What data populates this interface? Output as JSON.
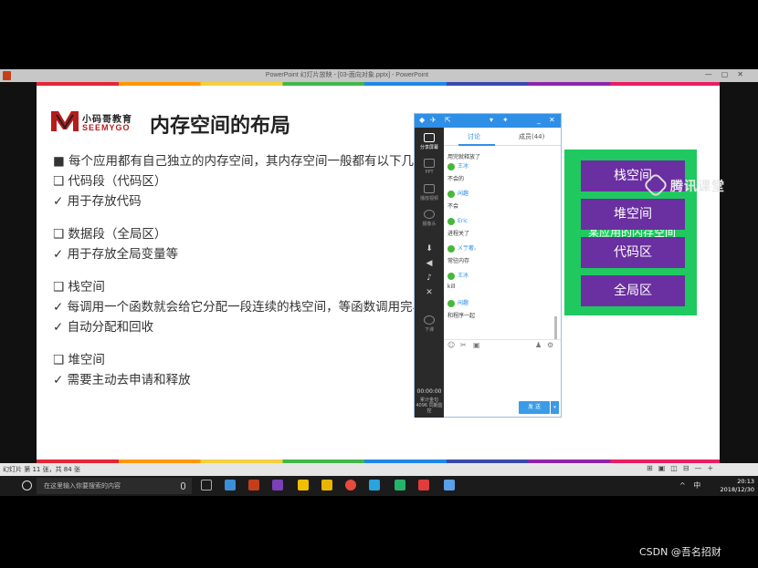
{
  "ppt": {
    "window_title": "PowerPoint 幻灯片放映 - [03-面向对象.pptx] - PowerPoint",
    "status_text": "幻灯片 第 11 张，共 84 张"
  },
  "slide": {
    "brand_cn": "小码哥教育",
    "brand_en": "SEEMYGO",
    "title": "内存空间的布局",
    "bullets": [
      "■ 每个应用都有自己独立的内存空间，其内存空间一般都有以下几个区域",
      "❑ 代码段（代码区）",
      "✓ 用于存放代码",
      "❑ 数据段（全局区）",
      "✓ 用于存放全局变量等",
      "❑ 栈空间",
      "✓ 每调用一个函数就会给它分配一段连续的栈空间，等函数调用完毕后会自动回收这段栈空间",
      "✓ 自动分配和回收",
      "❑ 堆空间",
      "✓ 需要主动去申请和释放"
    ],
    "memory_cells": [
      "栈空间",
      "堆空间",
      "代码区",
      "全局区"
    ],
    "memory_ghost": "某应用的内存空间",
    "colors": {
      "memory_bg": "#1fc95f",
      "cell_bg": "#6a2fa0"
    }
  },
  "watermark": "腾讯课堂",
  "chat": {
    "sidebar": [
      "分享屏幕",
      "PPT",
      "播放视频",
      "摄像头",
      "下课"
    ],
    "time": "00:00:00",
    "stats": "累计金句 4096 同期监控",
    "tabs": {
      "discuss": "讨论",
      "members": "成员(44)"
    },
    "first_text": "用完就释放了",
    "messages": [
      {
        "user": "王冰",
        "text": "不会的"
      },
      {
        "user": "闲趣",
        "text": "不会"
      },
      {
        "user": "Eric",
        "text": "进程关了"
      },
      {
        "user": "ㄨ亍奢。",
        "text": "常驻内存"
      },
      {
        "user": "王冰",
        "text": "kill"
      },
      {
        "user": "闲趣",
        "text": "和程序一起"
      }
    ],
    "send_label": "发 送"
  },
  "taskbar": {
    "search_placeholder": "在这里输入你要搜索的内容",
    "time": "20:13",
    "date": "2018/12/30",
    "ime": "中"
  },
  "credit": "CSDN @吾名招财"
}
